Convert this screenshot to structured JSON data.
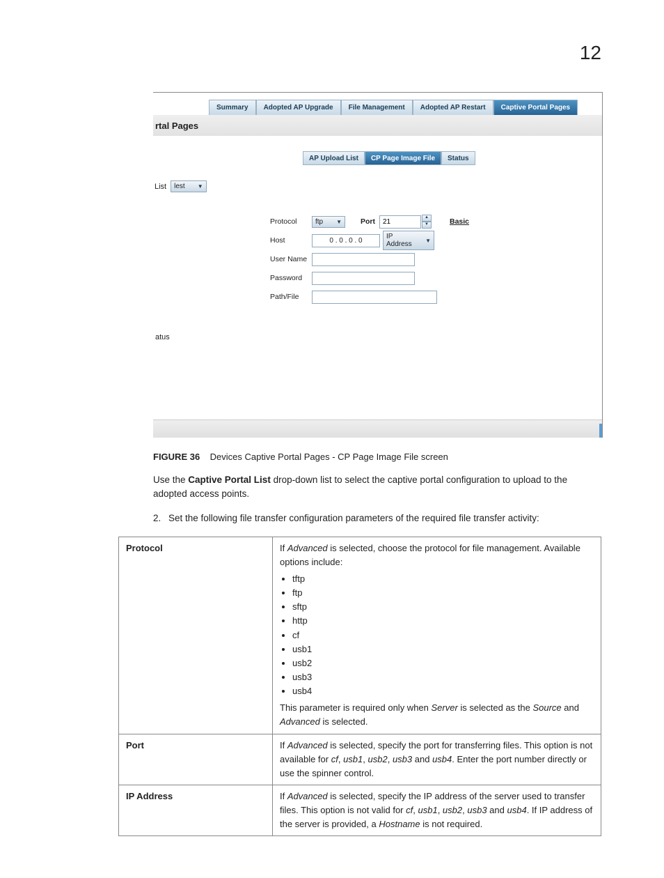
{
  "page_number": "12",
  "screenshot": {
    "tabs": [
      "Summary",
      "Adopted AP Upgrade",
      "File Management",
      "Adopted AP Restart",
      "Captive Portal Pages"
    ],
    "active_tab_index": 4,
    "crumb": "rtal Pages",
    "inner_tabs": [
      "AP Upload List",
      "CP Page Image File",
      "Status"
    ],
    "inner_active_index": 1,
    "list_label": "List",
    "list_value": "lest",
    "form": {
      "protocol_label": "Protocol",
      "protocol_value": "ftp",
      "port_label": "Port",
      "port_value": "21",
      "basic_label": "Basic",
      "host_label": "Host",
      "host_ip": "0  .   0  .   0  .   0",
      "ip_mode": "IP Address",
      "username_label": "User Name",
      "password_label": "Password",
      "pathfile_label": "Path/File"
    },
    "tatus": "atus"
  },
  "figure": {
    "label": "FIGURE 36",
    "title": "Devices Captive Portal Pages - CP Page Image File screen"
  },
  "para1_pre": "Use the ",
  "para1_bold": "Captive Portal List",
  "para1_post": " drop-down list to select the captive portal configuration to upload to the adopted access points.",
  "step2_num": "2.",
  "step2_text": "Set the following file transfer configuration parameters of the required file transfer activity:",
  "table": {
    "protocol": {
      "name": "Protocol",
      "pre": "If ",
      "adv": "Advanced",
      "post1": " is selected, choose the protocol for file management. Available options include:",
      "options": [
        "tftp",
        "ftp",
        "sftp",
        "http",
        "cf",
        "usb1",
        "usb2",
        "usb3",
        "usb4"
      ],
      "tail_pre": "This parameter is required only when ",
      "tail_server": "Server",
      "tail_mid": " is selected as the ",
      "tail_source": "Source",
      "tail_and": " and ",
      "tail_adv": "Advanced",
      "tail_end": " is selected."
    },
    "port": {
      "name": "Port",
      "t1": "If ",
      "adv": "Advanced",
      "t2": " is selected, specify the port for transferring files. This option is not available for ",
      "cf": "cf",
      "c": ", ",
      "u1": "usb1",
      "u2": "usb2",
      "u3": "usb3",
      "and": " and ",
      "u4": "usb4",
      "t3": ". Enter the port number directly or use the spinner control."
    },
    "ip": {
      "name": "IP Address",
      "t1": "If ",
      "adv": "Advanced",
      "t2": " is selected, specify the IP address of the server used to transfer files. This option is not valid for ",
      "cf": "cf",
      "c": ", ",
      "u1": "usb1",
      "u2": "usb2",
      "u3": "usb3",
      "and": " and ",
      "u4": "usb4",
      "t3": ". If IP address of the server is provided, a ",
      "hostname": "Hostname",
      "t4": " is not required."
    }
  }
}
